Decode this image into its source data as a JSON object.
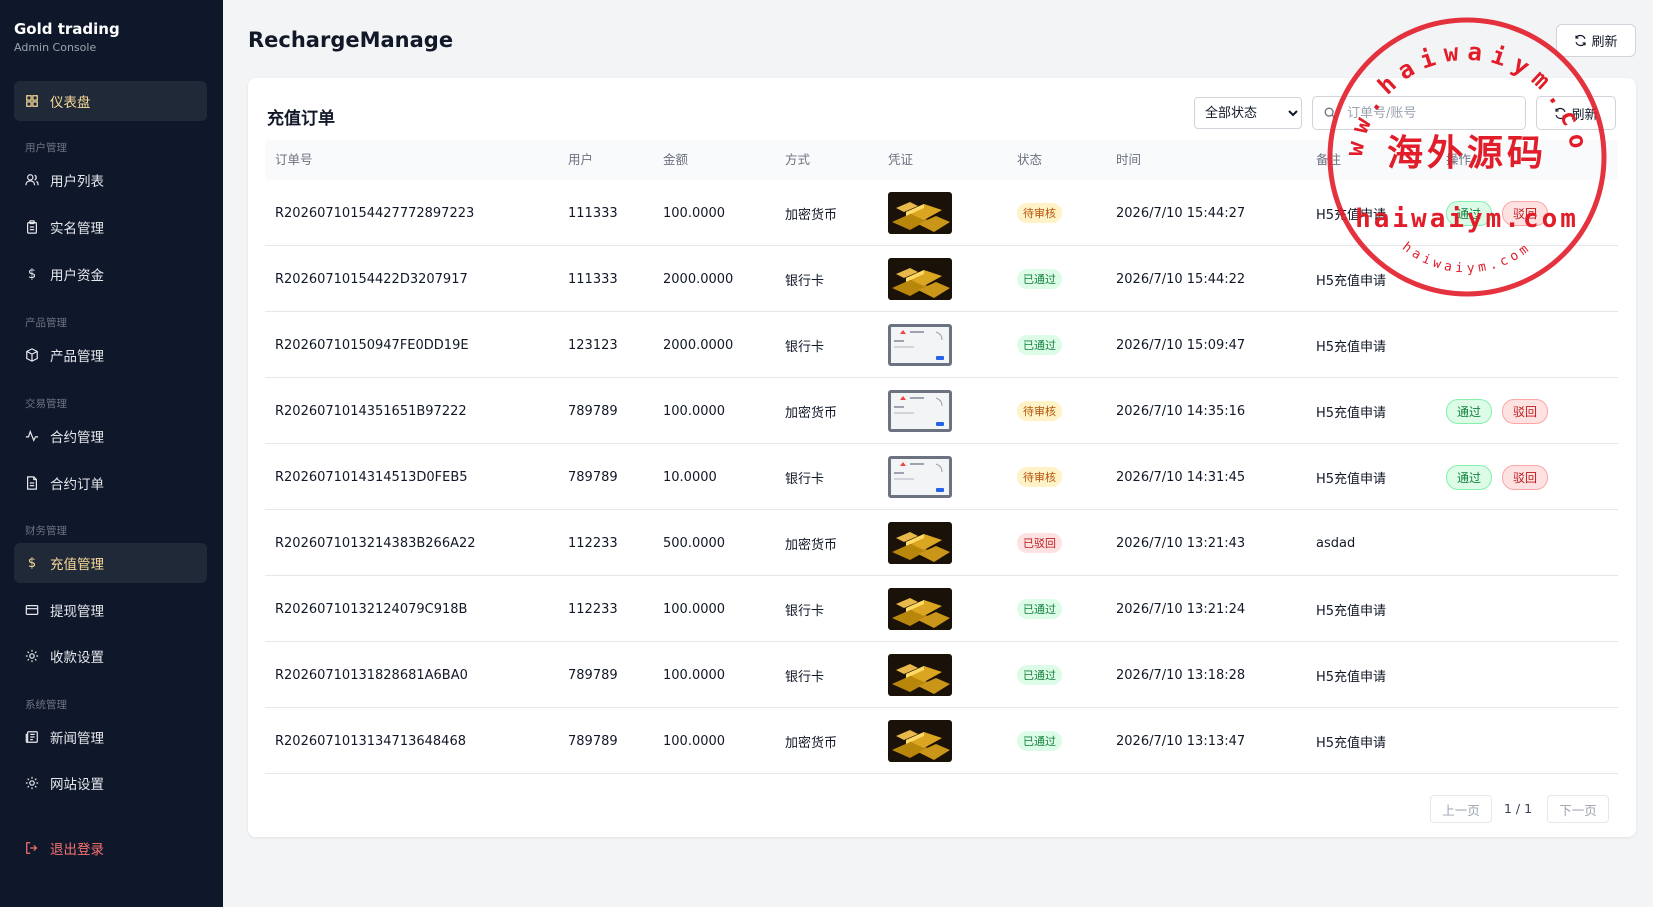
{
  "sidebar": {
    "brand_title": "Gold trading",
    "brand_subtitle": "Admin Console",
    "dashboard": "仪表盘",
    "groups": {
      "users": "用户管理",
      "products": "产品管理",
      "trading": "交易管理",
      "finance": "财务管理",
      "system": "系统管理"
    },
    "items": {
      "user_list": "用户列表",
      "kyc": "实名管理",
      "user_funds": "用户资金",
      "product_manage": "产品管理",
      "contract_manage": "合约管理",
      "contract_orders": "合约订单",
      "recharge_manage": "充值管理",
      "withdraw_manage": "提现管理",
      "payment_settings": "收款设置",
      "news_manage": "新闻管理",
      "site_settings": "网站设置"
    },
    "logout": "退出登录"
  },
  "header": {
    "title": "RechargeManage",
    "refresh": "刷新"
  },
  "card": {
    "title": "充值订单",
    "status_filter": "全部状态",
    "search_placeholder": "订单号/账号",
    "refresh": "刷新"
  },
  "table": {
    "headers": {
      "order_no": "订单号",
      "user": "用户",
      "amount": "金额",
      "method": "方式",
      "proof": "凭证",
      "status": "状态",
      "time": "时间",
      "note": "备注",
      "actions": "操作"
    },
    "approve_label": "通过",
    "reject_label": "驳回",
    "rows": [
      {
        "order_no": "R202607101544277728972​23",
        "user": "111333",
        "amount": "100.0000",
        "method": "加密货币",
        "proof": "gold",
        "status": "待审核",
        "status_type": "pending",
        "time": "2026/7/10 15:44:27",
        "note": "H5充值申请",
        "actions": true
      },
      {
        "order_no": "R20260710154422D3207917",
        "user": "111333",
        "amount": "2000.0000",
        "method": "银行卡",
        "proof": "gold",
        "status": "已通过",
        "status_type": "approved",
        "time": "2026/7/10 15:44:22",
        "note": "H5充值申请",
        "actions": false
      },
      {
        "order_no": "R20260710150947FE0DD19E",
        "user": "123123",
        "amount": "2000.0000",
        "method": "银行卡",
        "proof": "screenshot",
        "status": "已通过",
        "status_type": "approved",
        "time": "2026/7/10 15:09:47",
        "note": "H5充值申请",
        "actions": false
      },
      {
        "order_no": "R2026071014351651B97222",
        "user": "789789",
        "amount": "100.0000",
        "method": "加密货币",
        "proof": "screenshot",
        "status": "待审核",
        "status_type": "pending",
        "time": "2026/7/10 14:35:16",
        "note": "H5充值申请",
        "actions": true
      },
      {
        "order_no": "R2026071014314513D0FEB5",
        "user": "789789",
        "amount": "10.0000",
        "method": "银行卡",
        "proof": "screenshot",
        "status": "待审核",
        "status_type": "pending",
        "time": "2026/7/10 14:31:45",
        "note": "H5充值申请",
        "actions": true
      },
      {
        "order_no": "R2026071013214383B266A22",
        "user": "112233",
        "amount": "500.0000",
        "method": "加密货币",
        "proof": "gold",
        "status": "已驳回",
        "status_type": "rejected",
        "time": "2026/7/10 13:21:43",
        "note": "asdad",
        "actions": false
      },
      {
        "order_no": "R20260710132124079C918B",
        "user": "112233",
        "amount": "100.0000",
        "method": "银行卡",
        "proof": "gold",
        "status": "已通过",
        "status_type": "approved",
        "time": "2026/7/10 13:21:24",
        "note": "H5充值申请",
        "actions": false
      },
      {
        "order_no": "R20260710131828681A6BA0",
        "user": "789789",
        "amount": "100.0000",
        "method": "银行卡",
        "proof": "gold",
        "status": "已通过",
        "status_type": "approved",
        "time": "2026/7/10 13:18:28",
        "note": "H5充值申请",
        "actions": false
      },
      {
        "order_no": "R20260710131347136484​68",
        "user": "789789",
        "amount": "100.0000",
        "method": "加密货币",
        "proof": "gold",
        "status": "已通过",
        "status_type": "approved",
        "time": "2026/7/10 13:13:47",
        "note": "H5充值申请",
        "actions": false
      }
    ]
  },
  "pagination": {
    "prev": "上一页",
    "info": "1 / 1",
    "next": "下一页"
  },
  "watermark": {
    "url_top": "www.haiwaiym.com",
    "cn_text": "海外源码",
    "url_mid": "haiwaiym.com",
    "url_bottom": "haiwaiym.com"
  },
  "colors": {
    "sidebar_bg": "#0f172a",
    "active_text": "#f8d99a",
    "logout": "#f87171",
    "stamp_red": "#e11d2a"
  }
}
